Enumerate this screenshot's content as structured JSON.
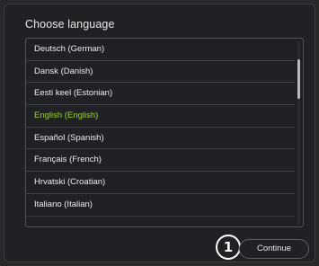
{
  "dialog": {
    "title": "Choose language"
  },
  "languages": [
    {
      "label": "Deutsch (German)",
      "selected": false
    },
    {
      "label": "Dansk (Danish)",
      "selected": false
    },
    {
      "label": "Eesti keel (Estonian)",
      "selected": false
    },
    {
      "label": "English (English)",
      "selected": true
    },
    {
      "label": "Español (Spanish)",
      "selected": false
    },
    {
      "label": "Français (French)",
      "selected": false
    },
    {
      "label": "Hrvatski (Croatian)",
      "selected": false
    },
    {
      "label": "Italiano (Italian)",
      "selected": false
    }
  ],
  "colors": {
    "selected_text": "#9bd43a",
    "background": "#1f2124"
  },
  "footer": {
    "continue_label": "Continue",
    "step_marker": "1"
  }
}
